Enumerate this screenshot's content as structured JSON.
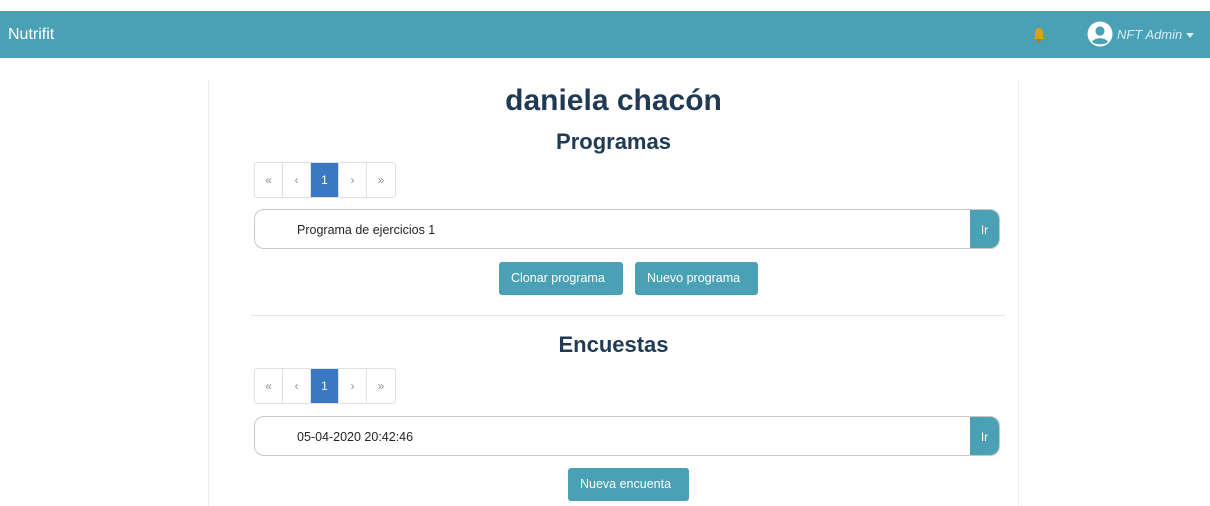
{
  "navbar": {
    "brand": "Nutrifit",
    "user_name": "NFT Admin",
    "icons": {
      "bell": "bell-icon",
      "user": "user-avatar-icon",
      "caret": "caret-down-icon"
    },
    "colors": {
      "bar": "#4aa0b5",
      "bell": "#d9a300"
    }
  },
  "main": {
    "patient_name": "daniela chacón",
    "programs": {
      "heading": "Programas",
      "pagination": [
        "«",
        "‹",
        "1",
        "›",
        "»"
      ],
      "active_page": "1",
      "items": [
        {
          "label": "Programa de ejercicios 1",
          "go_label": "Ir"
        }
      ],
      "clone_button": "Clonar programa",
      "new_button": "Nuevo programa"
    },
    "surveys": {
      "heading": "Encuestas",
      "pagination": [
        "«",
        "‹",
        "1",
        "›",
        "»"
      ],
      "active_page": "1",
      "items": [
        {
          "label": "05-04-2020 20:42:46",
          "go_label": "Ir"
        }
      ],
      "new_button": "Nueva encuenta"
    },
    "colors": {
      "accent": "#4aa0b5",
      "active_page": "#3a78c3",
      "heading": "#1f3a52"
    }
  }
}
